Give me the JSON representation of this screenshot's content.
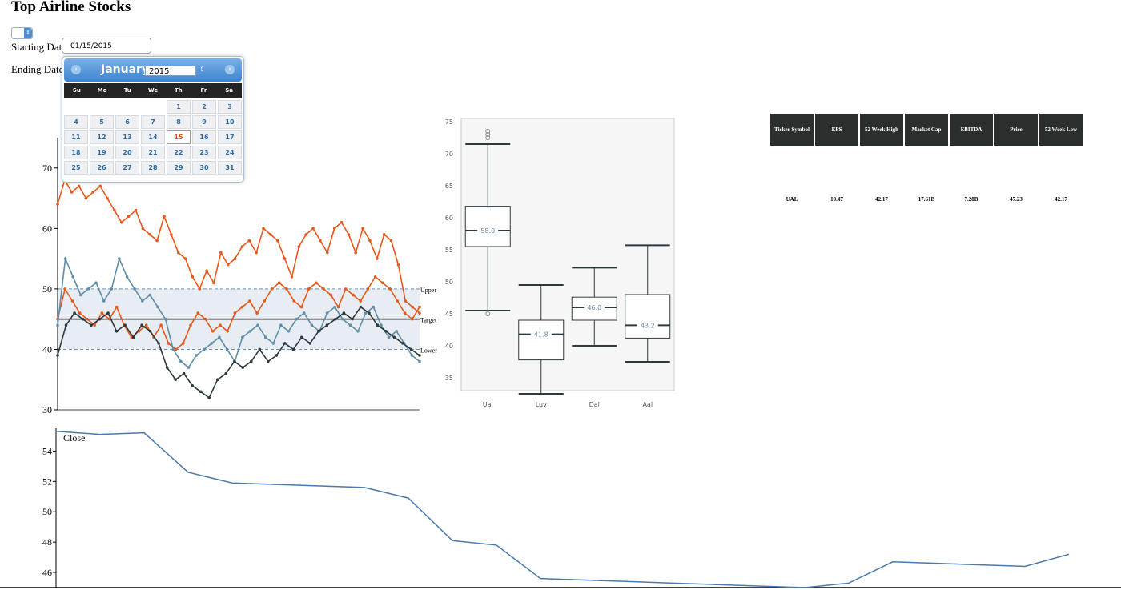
{
  "page": {
    "title": "Top Airline Stocks"
  },
  "form": {
    "starting_label": "Starting Date",
    "starting_value": "01/15/2015",
    "ending_label": "Ending Date"
  },
  "calendar": {
    "month": "January",
    "year": "2015",
    "weekdays": [
      "Su",
      "Mo",
      "Tu",
      "We",
      "Th",
      "Fr",
      "Sa"
    ],
    "first_weekday_index": 4,
    "days_in_month": 31,
    "selected_day": 15,
    "prev_icon": "chevron-left-icon",
    "next_icon": "chevron-right-icon"
  },
  "colors": {
    "orange": "#e8581b",
    "blue": "#5f8ea8",
    "dark": "#2c3a3e",
    "band": "#dde6ee",
    "line": "#4a7aad"
  },
  "charts": {
    "price_lines": {
      "type": "line",
      "ylim": [
        30,
        75
      ],
      "y_ticks": [
        30,
        40,
        50,
        60,
        70
      ],
      "reference_lines": [
        {
          "label": "Upper",
          "value": 50
        },
        {
          "label": "Target",
          "value": 45
        },
        {
          "label": "Lower",
          "value": 40
        }
      ],
      "series": [
        {
          "color": "orange",
          "values": [
            64,
            68,
            66,
            67,
            65,
            66,
            67,
            65,
            63,
            61,
            62,
            63,
            60,
            59,
            58,
            62,
            59,
            56,
            55,
            52,
            50,
            53,
            51,
            56,
            54,
            55,
            57,
            58,
            56,
            60,
            59,
            58,
            55,
            52,
            57,
            59,
            60,
            58,
            56,
            60,
            61,
            59,
            56,
            60,
            58,
            55,
            59,
            58,
            54,
            48,
            47,
            46
          ]
        },
        {
          "color": "orange",
          "values": [
            45,
            50,
            48,
            46,
            45,
            44,
            46,
            45,
            47,
            44,
            42,
            43,
            44,
            42,
            44,
            41,
            40,
            41,
            44,
            46,
            45,
            43,
            44,
            43,
            46,
            47,
            48,
            46,
            48,
            50,
            51,
            50,
            48,
            47,
            50,
            51,
            50,
            49,
            47,
            50,
            49,
            48,
            50,
            52,
            51,
            50,
            48,
            46,
            45,
            47
          ]
        },
        {
          "color": "blue",
          "values": [
            44,
            55,
            52,
            49,
            50,
            51,
            48,
            50,
            55,
            52,
            50,
            48,
            49,
            47,
            45,
            40,
            38,
            37,
            39,
            40,
            41,
            42,
            40,
            38,
            42,
            43,
            44,
            42,
            41,
            44,
            43,
            45,
            46,
            44,
            43,
            46,
            47,
            45,
            44,
            43,
            46,
            47,
            44,
            42,
            43,
            41,
            39,
            38
          ]
        },
        {
          "color": "dark",
          "values": [
            39,
            44,
            46,
            45,
            44,
            45,
            46,
            43,
            44,
            42,
            44,
            43,
            41,
            37,
            35,
            36,
            34,
            33,
            32,
            35,
            36,
            38,
            37,
            38,
            40,
            38,
            39,
            41,
            40,
            42,
            41,
            43,
            44,
            45,
            46,
            45,
            47,
            46,
            44,
            43,
            42,
            41,
            40,
            39
          ]
        }
      ]
    },
    "boxplot": {
      "type": "box",
      "ylim": [
        33,
        75.5
      ],
      "y_ticks": [
        35,
        40,
        45,
        50,
        55,
        60,
        65,
        70,
        75
      ],
      "categories": [
        "Ual",
        "Luv",
        "Dal",
        "Aal"
      ],
      "boxes": [
        {
          "name": "Ual",
          "min": 45.5,
          "q1": 55.5,
          "median": 58.0,
          "q3": 61.8,
          "max": 71.5,
          "outliers": [
            72.5,
            73.0,
            73.5,
            45.0
          ]
        },
        {
          "name": "Luv",
          "min": 32.5,
          "q1": 37.8,
          "median": 41.8,
          "q3": 44.0,
          "max": 49.5,
          "outliers": []
        },
        {
          "name": "Dal",
          "min": 40.0,
          "q1": 44.0,
          "median": 46.0,
          "q3": 47.6,
          "max": 52.2,
          "outliers": []
        },
        {
          "name": "Aal",
          "min": 37.5,
          "q1": 41.2,
          "median": 43.2,
          "q3": 48.0,
          "max": 55.7,
          "outliers": []
        }
      ],
      "median_labels": [
        "58.0",
        "41.8",
        "46.0",
        "43.2"
      ]
    },
    "close": {
      "type": "line",
      "label": "Close",
      "ylim": [
        45,
        55.5
      ],
      "y_ticks": [
        46,
        48,
        50,
        52,
        54
      ],
      "values": [
        55.3,
        55.1,
        55.2,
        52.6,
        51.9,
        51.8,
        51.7,
        51.6,
        50.9,
        48.1,
        47.8,
        45.6,
        45.5,
        45.4,
        45.3,
        45.2,
        45.1,
        45.0,
        45.3,
        46.7,
        46.6,
        46.5,
        46.4,
        47.2
      ]
    }
  },
  "table": {
    "headers": [
      "Ticker Symbol",
      "EPS",
      "52 Week High",
      "Market Cap",
      "EBITDA",
      "Price",
      "52 Week Low"
    ],
    "rows": [
      [
        "UAL",
        "19.47",
        "42.17",
        "17.61B",
        "7.28B",
        "47.23",
        "42.17"
      ]
    ]
  }
}
